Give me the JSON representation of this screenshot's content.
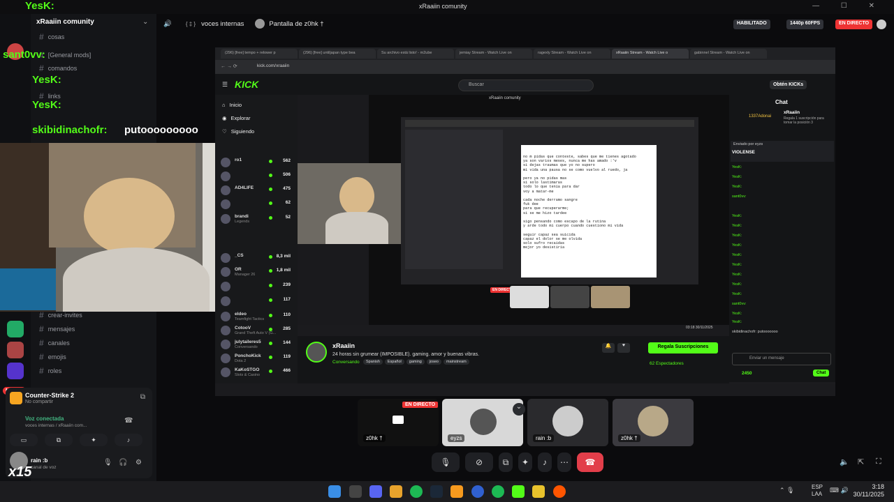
{
  "window": {
    "title": "xRaaiin comunity"
  },
  "sidebar": {
    "server_name": "xRaaiin comunity",
    "overlay_names": [
      "YesK:",
      "sant0vv:",
      "YesK:",
      "YesK:",
      "skibidinachofr:"
    ],
    "overlay_message": "putooooooooo",
    "channels_top": [
      {
        "label": "cosas"
      },
      {
        "label": "[General mods]"
      },
      {
        "label": "comandos"
      },
      {
        "label": "links"
      }
    ],
    "channels": [
      {
        "label": "crear-invites"
      },
      {
        "label": "mensajes"
      },
      {
        "label": "canales"
      },
      {
        "label": "emojis"
      },
      {
        "label": "roles"
      }
    ],
    "new_badge": "NUEVO"
  },
  "call_header": {
    "voice_channel": "voces internas",
    "screen_share": "Pantalla de z0hk †",
    "status_habilitado": "HABILITADO",
    "quality": "1440p 60FPS",
    "live": "EN DIRECTO"
  },
  "browser": {
    "tabs": [
      "(296) [free] tempo + relower p",
      "(296) [free] untiljapan type bea",
      "Su archivo está listo! - m2ube",
      "jemiay Stream - Watch Live on",
      "ragexly Stream - Watch Live on",
      "xRaaiin Stream - Watch Live o",
      "gabinnel Stream - Watch Live on"
    ],
    "url": "kick.com/xraaiin"
  },
  "kick": {
    "logo": "KICK",
    "search_placeholder": "Buscar",
    "get_kicks": "Obtén KICKs",
    "nav": [
      "Inicio",
      "Explorar",
      "Siguiendo"
    ],
    "streams": [
      {
        "name": "ro1",
        "sub": "",
        "viewers": "562"
      },
      {
        "name": "",
        "sub": "",
        "viewers": "506"
      },
      {
        "name": "AD4LIFE",
        "sub": "",
        "viewers": "475"
      },
      {
        "name": "",
        "sub": "",
        "viewers": "62"
      },
      {
        "name": "brandi",
        "sub": "Legends",
        "viewers": "52"
      },
      {
        "name": "_CS",
        "sub": "",
        "viewers": "8,3 mil"
      },
      {
        "name": "OR",
        "sub": "Manager 26",
        "viewers": "1,8 mil"
      },
      {
        "name": "",
        "sub": "",
        "viewers": "239"
      },
      {
        "name": "",
        "sub": "",
        "viewers": "117"
      },
      {
        "name": "eldeo",
        "sub": "Teamfight Tactics",
        "viewers": "110"
      },
      {
        "name": "CotooV",
        "sub": "Grand Theft Auto V (G...",
        "viewers": "285"
      },
      {
        "name": "julytaileres5",
        "sub": "Conversando",
        "viewers": "144"
      },
      {
        "name": "PonchoKick",
        "sub": "Dota 2",
        "viewers": "119"
      },
      {
        "name": "KaKoSTGO",
        "sub": "Slots & Casino",
        "viewers": "466"
      }
    ],
    "streamer": "xRaaiin",
    "stream_title": "24 horas sin grumear (IMPOSIBLE). gaming. amor y buenas vibras.",
    "category": "Conversando",
    "tags": [
      "Spanish",
      "Español",
      "gaming",
      "joseo",
      "mainstream"
    ],
    "gift_btn": "Regala Suscripciones",
    "viewers": "62 Espectadores",
    "chat_title": "Chat",
    "chat_gifter": "1337Adonai",
    "chat_gifter_name": "xRaaiin",
    "chat_gift_text": "Regala 1 suscripción para tomar la posición 3",
    "sent_by": "Enviado por eyzs",
    "violense": "VIOLENSE",
    "chat_names": [
      "YesK:",
      "YesK:",
      "YesK:",
      "sant0vv:",
      "YesK:",
      "YesK:",
      "YesK:",
      "YesK:",
      "YesK:",
      "YesK:",
      "YesK:",
      "YesK:",
      "YesK:",
      "sant0vv:",
      "YesK:",
      "YesK:",
      "YesK:"
    ],
    "chat_last": "skibidinachofr: putooooooo",
    "chat_placeholder": "Enviar un mensaje",
    "points": "2450",
    "chat_send": "Chat",
    "live_badge": "EN DIRECTO",
    "inner_title": "xRaaiin comunity",
    "inner_clock": "03:18",
    "inner_date": "30/11/2025"
  },
  "lyrics": "no m pidas que conteste, sabes que me tienes agotado\nya son varios meses, nunca me has amado :'v\nsi dejas traumas que yo no supero\nmi vida una pausa no se como vuelvo al ruedo, ja\n\npero ya no pidas mas\nsi solo lastimaras\ntodo lo que tenia para dar\nvoy a matar-me\n\ncada noche derramo sangre\nfuk dee\npara que recuperarme;\nsi se me hizo tardee\n\nsigo pensando como escapo de la rutina\ny arde todo mi cuerpo cuando cuestiono mi vida\n\nseguir capaz sea suicida\ncapaz el dolor se me olvida\nsolo sufro recaidas\nmejor yo desistiria",
  "participants": [
    {
      "name": "z0hk †",
      "live": "EN DIRECTO"
    },
    {
      "name": "eyzs"
    },
    {
      "name": "rain :b"
    },
    {
      "name": "z0hk †"
    }
  ],
  "user_panel": {
    "activity": "Counter-Strike 2",
    "activity_sub": "No compartir",
    "voice_status": "Voz conectada",
    "voice_channel": "voces internas / xRaaiin com...",
    "username": "rain :b",
    "usersub": "canal de voz",
    "overlay": "x15"
  },
  "taskbar": {
    "lang": "ESP",
    "lang2": "LAA",
    "time": "3:18",
    "date": "30/11/2025"
  }
}
